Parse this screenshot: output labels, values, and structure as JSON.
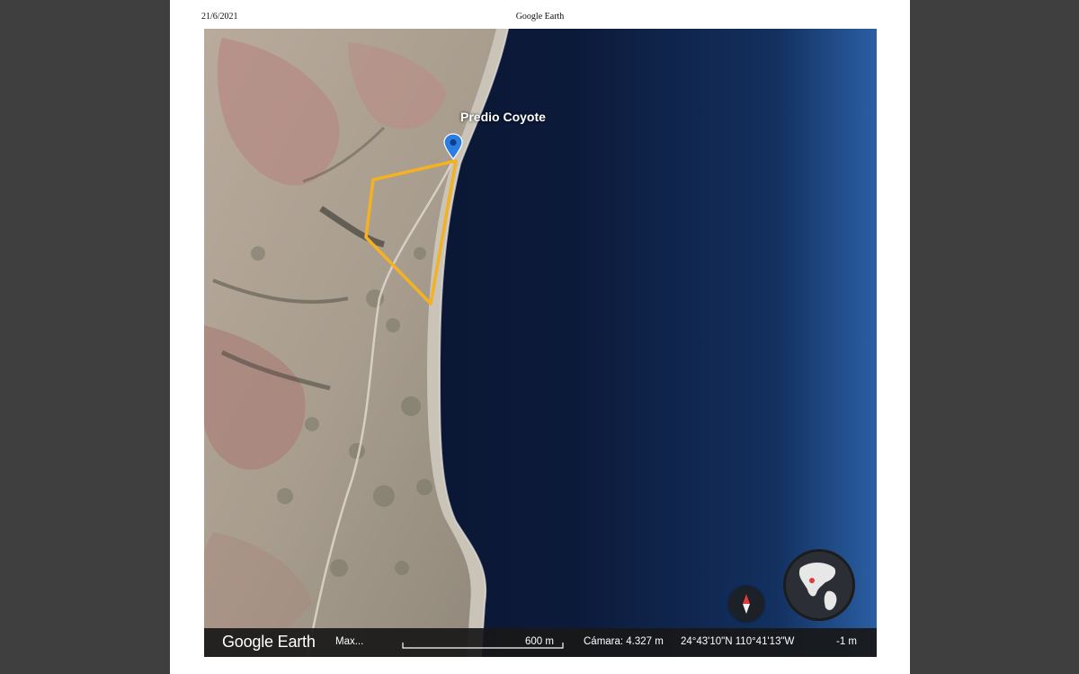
{
  "print_header": {
    "date": "21/6/2021",
    "title": "Google Earth"
  },
  "map": {
    "place_label": "Predio Coyote",
    "polygon_color": "#f4b223",
    "pin_color": "#2a7de1"
  },
  "statusbar": {
    "brand": "Google Earth",
    "layer_name": "Max...",
    "scale": "600 m",
    "camera": "Cámara: 4.327 m",
    "coordinates": "24°43'10\"N 110°41'13\"W",
    "elevation": "-1 m"
  },
  "controls": {
    "compass_icon": "compass-icon",
    "globe_icon": "globe-minimap-icon"
  }
}
